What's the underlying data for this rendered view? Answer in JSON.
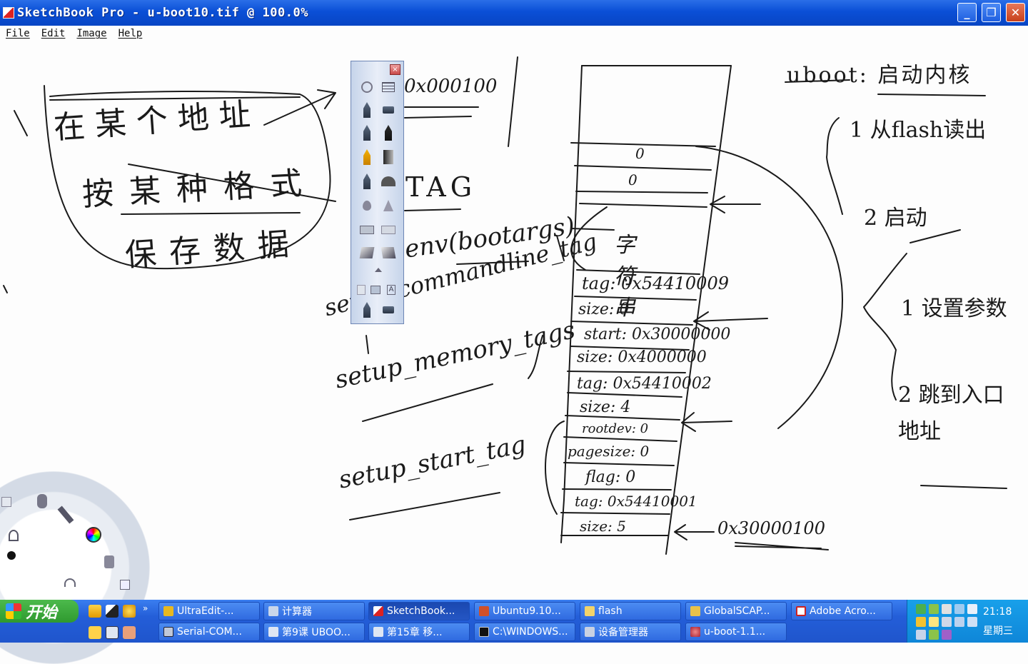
{
  "window": {
    "title": "SketchBook Pro - u-boot10.tif @ 100.0%",
    "minimize": "_",
    "maximize": "❐",
    "close": "✕"
  },
  "menu": [
    "File",
    "Edit",
    "Image",
    "Help"
  ],
  "canvas": {
    "handwriting": {
      "left_box": [
        "在某个地址",
        "按某种格式",
        "保存数据"
      ],
      "palette_overlap": [
        "0x000100",
        "TAG"
      ],
      "functions": [
        "setup_commandline_tag",
        "setup_memory_tags",
        "setup_start_tag"
      ],
      "bootargs": "env(bootargs)",
      "memory_stack": [
        "0",
        "0",
        "字符串",
        "tag: 0x54410009",
        "size: 0",
        "start: 0x30000000",
        "size: 0x4000000",
        "tag: 0x54410002",
        "size: 4",
        "rootdev: 0",
        "pagesize: 0",
        "flag: 0",
        "tag: 0x54410001",
        "size: 5"
      ],
      "address_label": "0x30000100",
      "right_notes": [
        "uboot: 启动内核",
        "1 从flash读出",
        "2 启动",
        "1 设置参数",
        "2 跳到入口地址"
      ]
    }
  },
  "palette": {
    "close": "×"
  },
  "taskbar": {
    "start": "开始",
    "row1": [
      "UltraEdit-...",
      "计算器",
      "SketchBook...",
      "Ubuntu9.10...",
      "flash",
      "GlobalSCAP...",
      "Adobe Acro..."
    ],
    "row2": [
      "Serial-COM...",
      "第9课 UBOO...",
      "第15章 移...",
      "C:\\WINDOWS...",
      "设备管理器",
      "u-boot-1.1..."
    ],
    "clock": "21:18",
    "day": "星期三"
  }
}
